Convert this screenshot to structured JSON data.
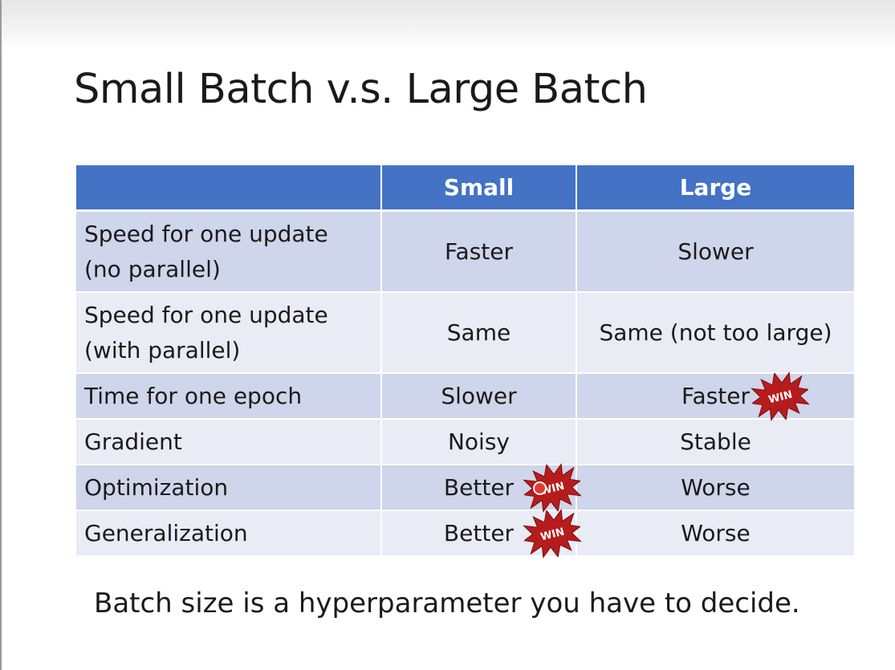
{
  "slide": {
    "title": "Small Batch v.s. Large Batch",
    "footer": "Batch size is a hyperparameter you have to decide."
  },
  "table": {
    "headers": [
      "",
      "Small",
      "Large"
    ],
    "rows": [
      {
        "label_line1": "Speed for one update",
        "label_line2": "(no parallel)",
        "small": "Faster",
        "large": "Slower"
      },
      {
        "label_line1": "Speed for one update",
        "label_line2": "(with parallel)",
        "small": "Same",
        "large": "Same (not too large)"
      },
      {
        "label": "Time for one epoch",
        "small": "Slower",
        "large": "Faster"
      },
      {
        "label": "Gradient",
        "small": "Noisy",
        "large": "Stable"
      },
      {
        "label": "Optimization",
        "small": "Better",
        "large": "Worse"
      },
      {
        "label": "Generalization",
        "small": "Better",
        "large": "Worse"
      }
    ]
  },
  "badge": {
    "text": "WIN",
    "color": "#b71c1c",
    "icon": "starburst-win-icon"
  },
  "colors": {
    "header_bg": "#4472c4",
    "row_dark": "#cfd5ea",
    "row_light": "#e9ebf5"
  }
}
